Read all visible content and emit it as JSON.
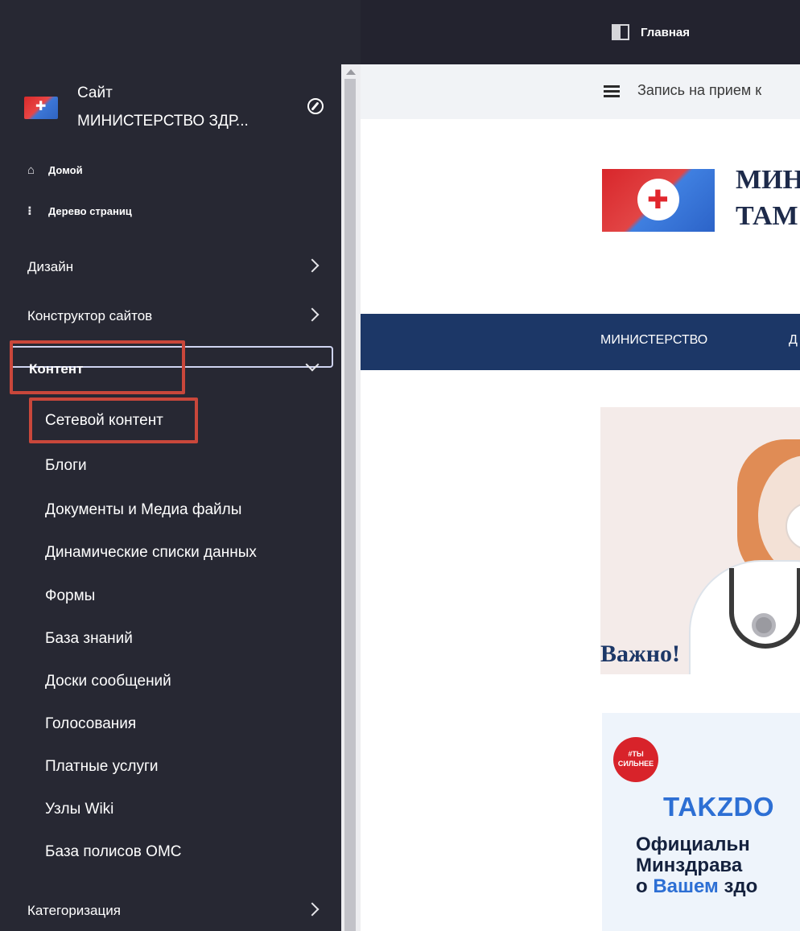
{
  "topbar": {
    "home_label": "Главная"
  },
  "site": {
    "title": "Сайт",
    "name": "МИНИСТЕРСТВО ЗДР..."
  },
  "quick_links": [
    {
      "label": "Домой",
      "icon": "home-icon"
    },
    {
      "label": "Дерево страниц",
      "icon": "page-tree-icon"
    }
  ],
  "menu": [
    {
      "label": "Дизайн",
      "expanded": false
    },
    {
      "label": "Конструктор сайтов",
      "expanded": false
    },
    {
      "label": "Контент",
      "expanded": true
    }
  ],
  "content_items": [
    "Сетевой контент",
    "Блоги",
    "Документы и Медиа файлы",
    "Динамические списки данных",
    "Формы",
    "База знаний",
    "Доски сообщений",
    "Голосования",
    "Платные услуги",
    "Узлы Wiki",
    "База полисов ОМС"
  ],
  "menu_bottom": {
    "label": "Категоризация",
    "expanded": false
  },
  "page": {
    "info_text": "Запись на прием к",
    "brand_lines": [
      "МИН",
      "ТАМ"
    ],
    "nav": [
      "МИНИСТЕРСТВО",
      "Д"
    ],
    "banner1_title": "Важно!",
    "banner2_badge": "#ТЫ\nСИЛЬНЕЕ",
    "banner2_brand": "TAKZDO",
    "banner2_lines": [
      "Официальн",
      "Минздрава",
      "о Вашем здо"
    ]
  },
  "colors": {
    "sidebar_bg": "#272833",
    "highlight": "#c9473b",
    "nav_bg": "#1c3767",
    "accent_blue": "#2d6fd4"
  }
}
